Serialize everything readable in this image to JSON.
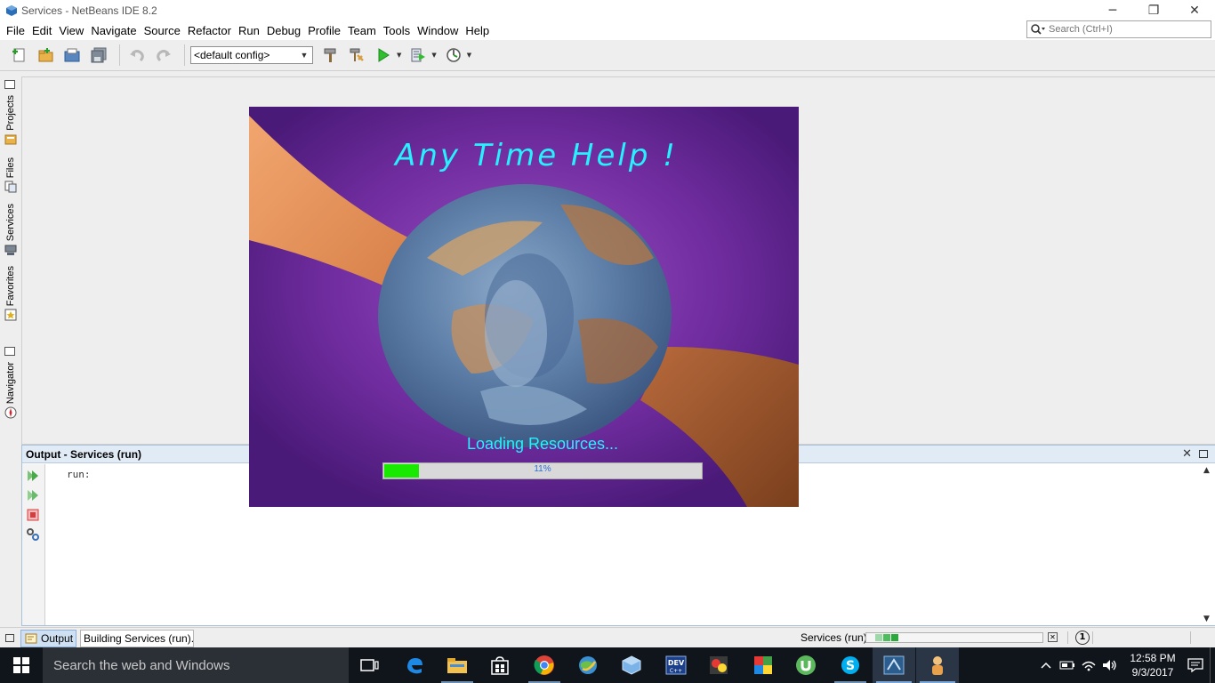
{
  "window": {
    "title": "Services - NetBeans IDE 8.2"
  },
  "menu": [
    "File",
    "Edit",
    "View",
    "Navigate",
    "Source",
    "Refactor",
    "Run",
    "Debug",
    "Profile",
    "Team",
    "Tools",
    "Window",
    "Help"
  ],
  "search": {
    "placeholder": "Search (Ctrl+I)"
  },
  "toolbar": {
    "config_value": "<default config>"
  },
  "sidebar": {
    "tabs": [
      {
        "label": "Projects",
        "icon": "projects-icon"
      },
      {
        "label": "Files",
        "icon": "files-icon"
      },
      {
        "label": "Services",
        "icon": "services-icon"
      },
      {
        "label": "Favorites",
        "icon": "favorites-icon"
      },
      {
        "label": "Navigator",
        "icon": "navigator-icon"
      }
    ]
  },
  "splash": {
    "title": "Any Time Help !",
    "loading_text": "Loading Resources...",
    "progress_label": "11%",
    "progress_value": 0.11,
    "colors": {
      "title": "#27f0ff",
      "progress_fill": "#19e800",
      "background": "#6a2a98"
    }
  },
  "output": {
    "title": "Output - Services (run)",
    "text": "run:"
  },
  "status": {
    "tabs": {
      "output": "Output",
      "building": "Building Services (run)..."
    },
    "task": "Services (run)",
    "notifications": "1"
  },
  "taskbar": {
    "search_placeholder": "Search the web and Windows",
    "apps": [
      "task-view",
      "edge",
      "file-explorer",
      "store",
      "chrome",
      "network-app",
      "virtualbox",
      "dev-cpp",
      "c-free",
      "winrar",
      "utorrent",
      "skype",
      "netbeans",
      "user-app"
    ],
    "clock": {
      "time": "12:58 PM",
      "date": "9/3/2017"
    }
  }
}
